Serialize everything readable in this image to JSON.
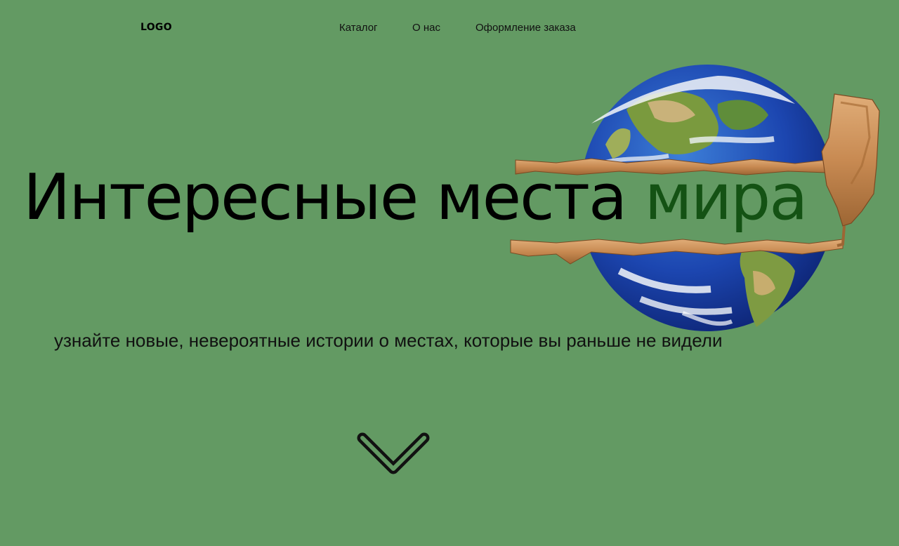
{
  "header": {
    "logo": "LOGO",
    "nav": [
      {
        "label": "Каталог"
      },
      {
        "label": "О нас"
      },
      {
        "label": "Оформление заказа"
      }
    ]
  },
  "hero": {
    "title_main": "Интересные места",
    "title_accent": "мира",
    "subtitle": "узнайте новые, невероятные истории о местах, которые вы раньше не видели",
    "image_icon": "torn-globe-illustration",
    "scroll_icon": "chevron-down-icon"
  },
  "colors": {
    "background": "#639a63",
    "accent_text": "#145214",
    "text": "#000000"
  }
}
